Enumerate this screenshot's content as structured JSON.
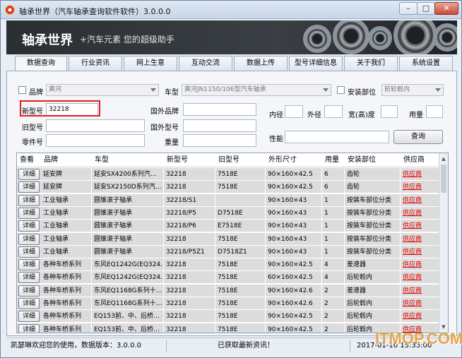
{
  "window": {
    "title": "轴承世界（汽车轴承查询软件软件）3.0.0.0",
    "min_label": "–",
    "max_label": "□",
    "close_label": "✕"
  },
  "banner": {
    "title": "轴承世界",
    "subtitle": "+汽车元素    您的超级助手"
  },
  "tabs": [
    "数据查询",
    "行业资讯",
    "网上生意",
    "互动交流",
    "数据上传",
    "型号详细信息",
    "关于我们",
    "系统设置"
  ],
  "form": {
    "brand_label": "品牌",
    "brand_value": "黄河",
    "model_label": "车型",
    "model_value": "黄河JN1150/106型汽车轴承",
    "position_label": "安装部位",
    "position_value": "前轮毂内",
    "new_no_label": "新型号",
    "new_no_value": "32218",
    "foreign_brand_label": "国外品牌",
    "inner_label": "内径",
    "outer_label": "外径",
    "width_label": "宽(高)度",
    "usage_label": "用量",
    "old_no_label": "旧型号",
    "foreign_no_label": "国外型号",
    "part_no_label": "零件号",
    "weight_label": "重量",
    "performance_label": "性能",
    "query_button": "查询"
  },
  "grid": {
    "columns": [
      "查看",
      "品牌",
      "车型",
      "新型号",
      "旧型号",
      "外形尺寸",
      "用量",
      "安装部位",
      "供应商"
    ],
    "detail_label": "详细",
    "rows": [
      [
        "延安牌",
        "延安SX4200系列汽…",
        "32218",
        "7518E",
        "90×160×42.5",
        "6",
        "齿轮",
        "供应商"
      ],
      [
        "延安牌",
        "延安SX2150D系列汽…",
        "32218",
        "7518E",
        "90×160×42.5",
        "6",
        "齿轮",
        "供应商"
      ],
      [
        "工业轴承",
        "圆锥滚子轴承",
        "32218/S1",
        "",
        "90×160×43",
        "1",
        "按装车部位分类",
        "供应商"
      ],
      [
        "工业轴承",
        "圆锥滚子轴承",
        "32218/P5",
        "D7518E",
        "90×160×43",
        "1",
        "按装车部位分类",
        "供应商"
      ],
      [
        "工业轴承",
        "圆锥滚子轴承",
        "32218/P6",
        "E7518E",
        "90×160×43",
        "1",
        "按装车部位分类",
        "供应商"
      ],
      [
        "工业轴承",
        "圆锥滚子轴承",
        "32218",
        "7518E",
        "90×160×43",
        "1",
        "按装车部位分类",
        "供应商"
      ],
      [
        "工业轴承",
        "圆锥滚子轴承",
        "32218/P5Z1",
        "D7518Z1",
        "90×160×43",
        "1",
        "按装车部位分类",
        "供应商"
      ],
      [
        "各种车桥系列",
        "东风EQ1242G(EQ324…",
        "32218",
        "7518E",
        "90×160×42.5",
        "4",
        "差速器",
        "供应商"
      ],
      [
        "各种车桥系列",
        "东风EQ1242G(EQ324…",
        "32218",
        "7518E",
        "60×160×42.5",
        "4",
        "后轮毂内",
        "供应商"
      ],
      [
        "各种车桥系列",
        "东风EQ1168G系列十…",
        "32218",
        "7518E",
        "90×160×42.6",
        "2",
        "差速器",
        "供应商"
      ],
      [
        "各种车桥系列",
        "东风EQ1168G系列十…",
        "32218",
        "7518E",
        "90×160×42.6",
        "2",
        "后轮毂内",
        "供应商"
      ],
      [
        "各种车桥系列",
        "EQ153前、中、后桥…",
        "32218",
        "7518E",
        "90×160×42.5",
        "2",
        "后轮毂内",
        "供应商"
      ],
      [
        "各种车桥系列",
        "EQ153前、中、后桥…",
        "32218",
        "7518E",
        "90×160×42.5",
        "2",
        "后轮毂内",
        "供应商"
      ]
    ]
  },
  "status": {
    "left": "凯瑟琳欢迎您的使用，数据版本：3.0.0.0",
    "middle": "已获取最新资讯！",
    "right": "2017-01-10 15:35:00"
  },
  "watermark": "ITMOP.COM"
}
